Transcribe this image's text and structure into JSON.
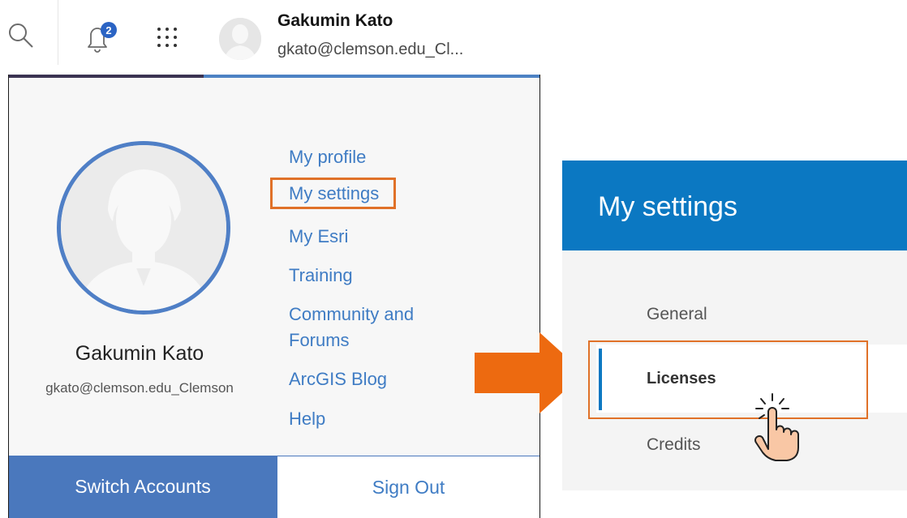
{
  "header": {
    "search_icon": "search-icon",
    "notification_icon": "bell-icon",
    "notification_count": "2",
    "apps_icon": "apps-grid-icon",
    "user_name": "Gakumin Kato",
    "user_email": "gkato@clemson.edu_Cl..."
  },
  "account_panel": {
    "name": "Gakumin Kato",
    "email": "gkato@clemson.edu_Clemson",
    "links": {
      "my_profile": "My profile",
      "my_settings": "My settings",
      "my_esri": "My Esri",
      "training": "Training",
      "community_line1": "Community and",
      "community_line2": "Forums",
      "arcgis_blog": "ArcGIS Blog",
      "help": "Help"
    },
    "switch_accounts": "Switch Accounts",
    "sign_out": "Sign Out"
  },
  "settings_panel": {
    "title": "My settings",
    "items": {
      "general": "General",
      "licenses": "Licenses",
      "credits": "Credits"
    }
  },
  "colors": {
    "link_blue": "#3f7cc4",
    "header_blue": "#0b78c2",
    "button_blue": "#4a78bd",
    "highlight_orange": "#e07128",
    "arrow_orange": "#ed6a10"
  }
}
